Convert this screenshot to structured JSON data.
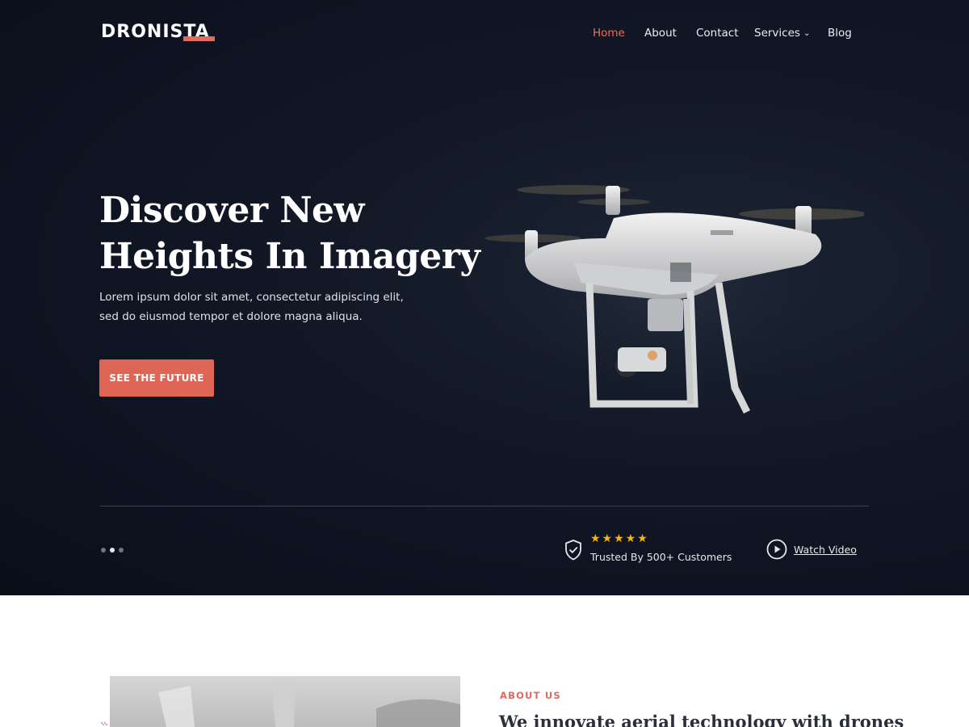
{
  "brand": {
    "logo_text": "DRONISTA",
    "accent_color": "#e06a5b"
  },
  "nav": {
    "items": [
      {
        "label": "Home",
        "active": true
      },
      {
        "label": "About",
        "active": false
      },
      {
        "label": "Contact",
        "active": false
      },
      {
        "label": "Services",
        "active": false,
        "has_dropdown": true
      },
      {
        "label": "Blog",
        "active": false
      }
    ],
    "dropdown_icon": "chevron-down-icon"
  },
  "hero": {
    "title_line1": "Discover New",
    "title_line2": "Heights In Imagery",
    "description": "Lorem ipsum dolor sit amet, consectetur adipiscing elit, sed do eiusmod tempor et dolore magna aliqua.",
    "cta_label": "SEE THE FUTURE",
    "cta_color": "#df6657",
    "image_subject": "white quadcopter drone"
  },
  "slider": {
    "dot_count": 3,
    "active_index": 1
  },
  "trust": {
    "icon": "shield-check-icon",
    "stars": "★★★★★",
    "rating": 5,
    "star_color": "#f5b50a",
    "text": "Trusted By 500+ Customers"
  },
  "video": {
    "icon": "play-icon",
    "label": "Watch Video"
  },
  "about": {
    "eyebrow": "ABOUT US",
    "heading": "We innovate aerial technology with drones"
  }
}
